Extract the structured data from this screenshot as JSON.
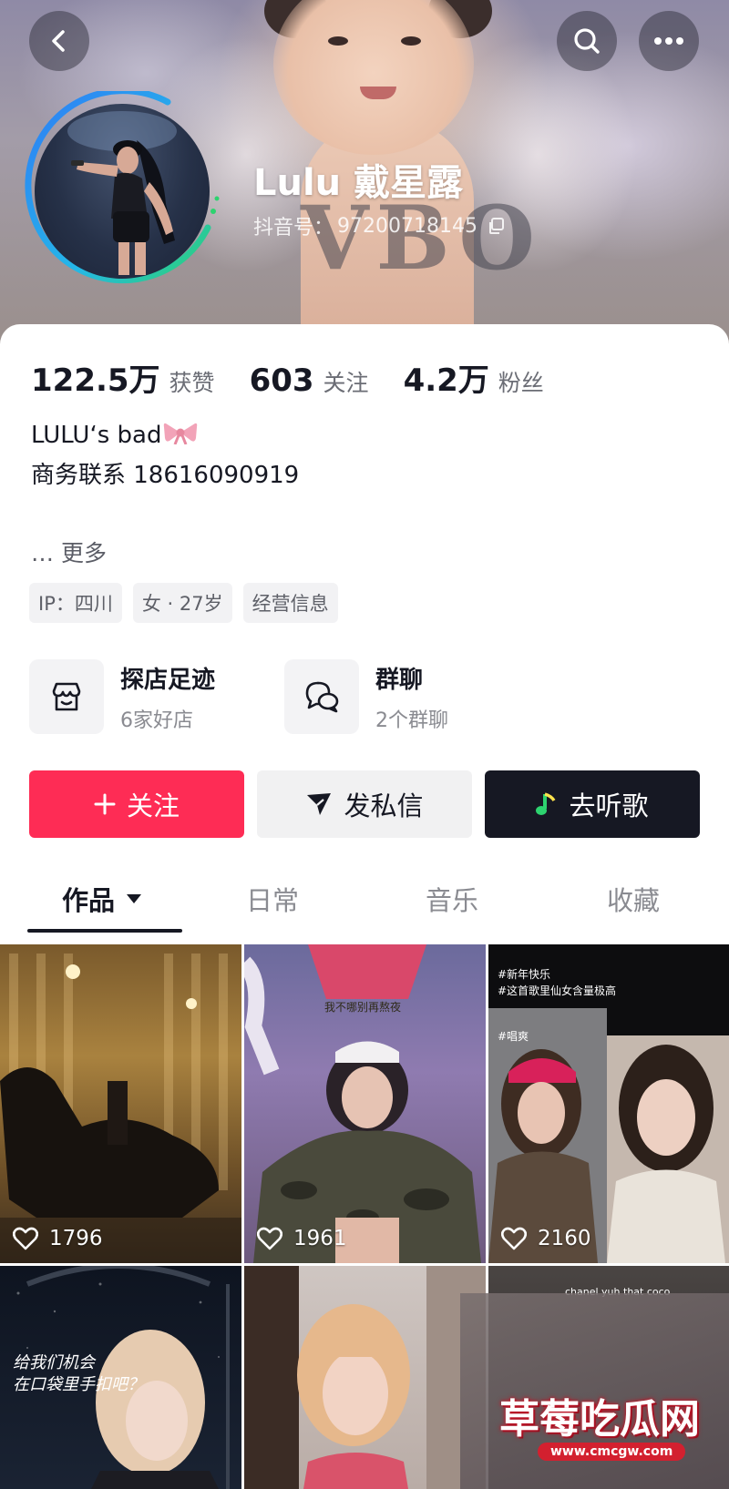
{
  "profile": {
    "name": "Lulu 戴星露",
    "douyin_id_label": "抖音号：",
    "douyin_id": "97200718145"
  },
  "stats": [
    {
      "value": "122.5万",
      "label": "获赞"
    },
    {
      "value": "603",
      "label": "关注"
    },
    {
      "value": "4.2万",
      "label": "粉丝"
    }
  ],
  "bio": {
    "line1": "LULU‘s bad",
    "line2": "商务联系 18616090919",
    "more": "… 更多"
  },
  "tags": [
    "IP：四川",
    "女 · 27岁",
    "经营信息"
  ],
  "features": [
    {
      "title": "探店足迹",
      "subtitle": "6家好店",
      "icon": "store-icon"
    },
    {
      "title": "群聊",
      "subtitle": "2个群聊",
      "icon": "chat-bubbles-icon"
    }
  ],
  "actions": {
    "follow": "关注",
    "message": "发私信",
    "music": "去听歌"
  },
  "tabs": [
    "作品",
    "日常",
    "音乐",
    "收藏"
  ],
  "videos": [
    {
      "likes": "1796"
    },
    {
      "likes": "1961",
      "caption": "我不哪别再熬夜"
    },
    {
      "likes": "2160",
      "caption": "#新年快乐\n#这首歌里仙女含量极高",
      "sub_caption": "#唱爽"
    },
    {
      "caption": "给我们机会\n在口袋里手扣吧？"
    },
    {},
    {
      "caption": "chanel yuh that coco"
    }
  ],
  "watermark": {
    "title": "草莓吃瓜网",
    "url": "www.cmcgw.com"
  },
  "colors": {
    "accent": "#fe2c55",
    "dark": "#161823",
    "ring_blue": "#2e7cf6",
    "ring_green": "#2dd36f"
  }
}
